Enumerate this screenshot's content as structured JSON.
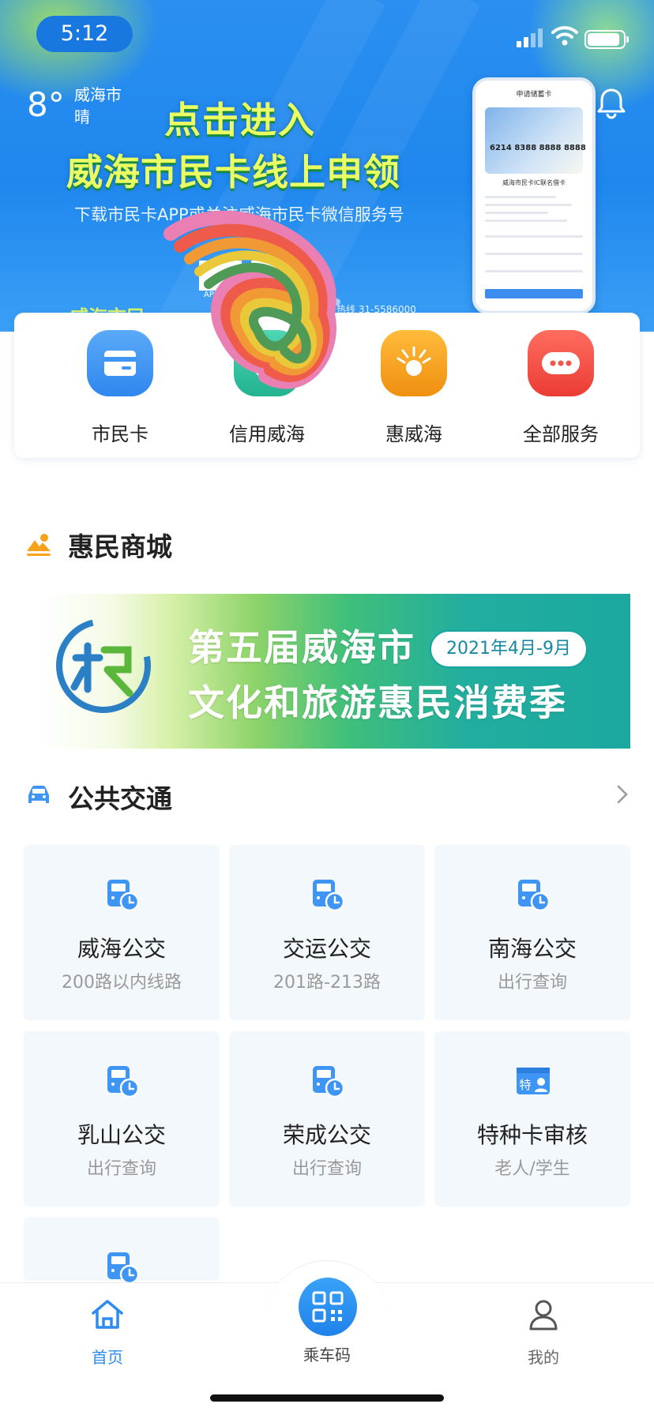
{
  "status_bar": {
    "time": "5:12"
  },
  "weather": {
    "temperature": "8°",
    "city": "威海市",
    "condition": "晴"
  },
  "banner": {
    "headline_1": "点击进入",
    "headline_2": "威海市民卡线上申领",
    "subtitle": "下载市民卡APP或关注威海市民卡微信服务号",
    "qr_label_1": "APP下载",
    "qr_label_2": "微信服务号",
    "hotline_label": "服务热线",
    "hotline_number": "31-5586000",
    "bottom_text": "威海市民",
    "phone_mockup": {
      "title": "申请储蓄卡",
      "card_number": "6214 8388 8888 8888",
      "card_caption": "威海市民卡IC联名借卡",
      "button": "下一步"
    },
    "slide_count": 5,
    "active_slide": 4
  },
  "services": [
    {
      "label": "市民卡",
      "icon": "card-icon",
      "color": "#3e95f4"
    },
    {
      "label": "信用威海",
      "icon": "shield-check-icon",
      "color": "#2fc3a0"
    },
    {
      "label": "惠威海",
      "icon": "sunburst-icon",
      "color": "#f7a21b"
    },
    {
      "label": "全部服务",
      "icon": "more-dots-icon",
      "color": "#f2554a"
    }
  ],
  "mall": {
    "title": "惠民商城",
    "banner": {
      "line_1": "第五届威海市",
      "line_2": "文化和旅游惠民消费季",
      "date_range": "2021年4月-9月",
      "logo_text": "旅"
    }
  },
  "transit": {
    "title": "公共交通",
    "tiles": [
      {
        "name": "威海公交",
        "sub": "200路以内线路",
        "icon": "bus-clock-icon"
      },
      {
        "name": "交运公交",
        "sub": "201路-213路",
        "icon": "bus-clock-icon"
      },
      {
        "name": "南海公交",
        "sub": "出行查询",
        "icon": "bus-clock-icon"
      },
      {
        "name": "乳山公交",
        "sub": "出行查询",
        "icon": "bus-clock-icon"
      },
      {
        "name": "荣成公交",
        "sub": "出行查询",
        "icon": "bus-clock-icon"
      },
      {
        "name": "特种卡审核",
        "sub": "老人/学生",
        "icon": "special-card-icon",
        "badge": "特"
      },
      {
        "name": "",
        "sub": "",
        "icon": "bus-clock-icon"
      }
    ]
  },
  "tabbar": {
    "home": "首页",
    "ride_code": "乘车码",
    "mine": "我的",
    "active": "home"
  },
  "colors": {
    "primary": "#2d8cf0",
    "banner_blue": "#1f87ee",
    "headline_yellow": "#eaff62",
    "tile_bg": "#f3f8fd"
  }
}
